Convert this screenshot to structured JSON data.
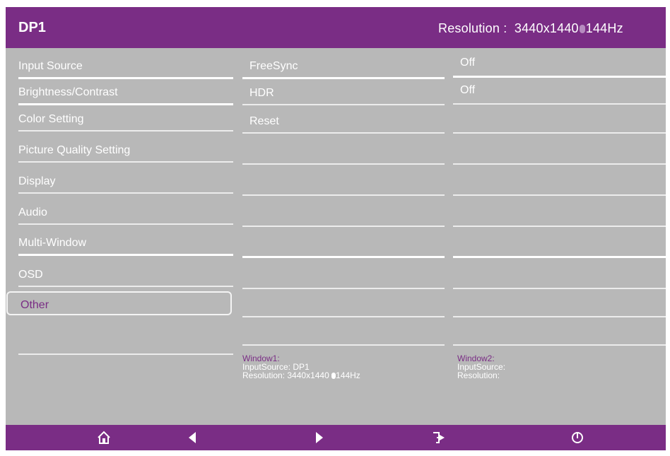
{
  "header": {
    "source": "DP1",
    "resolution_label": "Resolution :",
    "resolution_value": "3440x1440",
    "refresh": "144Hz"
  },
  "menu": {
    "items": [
      {
        "label": "Input Source"
      },
      {
        "label": "Brightness/Contrast"
      },
      {
        "label": "Color Setting"
      },
      {
        "label": "Picture Quality Setting"
      },
      {
        "label": "Display"
      },
      {
        "label": "Audio"
      },
      {
        "label": "Multi-Window"
      },
      {
        "label": "OSD"
      },
      {
        "label": "Other"
      }
    ],
    "selected_label": "Other"
  },
  "submenu": {
    "items": [
      {
        "label": "FreeSync"
      },
      {
        "label": "HDR"
      },
      {
        "label": "Reset"
      }
    ]
  },
  "values": {
    "items": [
      {
        "label": "Off"
      },
      {
        "label": "Off"
      }
    ]
  },
  "window1": {
    "title": "Window1:",
    "input_line": "InputSource:  DP1",
    "resolution_line_prefix": "Resolution:  3440x1440",
    "resolution_line_suffix": "144Hz"
  },
  "window2": {
    "title": "Window2:",
    "input_line": "InputSource:",
    "resolution_line": "Resolution:"
  },
  "footer": {
    "icons": [
      "home-icon",
      "left-arrow-icon",
      "right-arrow-icon",
      "exit-icon",
      "power-icon"
    ]
  },
  "colors": {
    "accent": "#7a2d85",
    "panel": "#b8b8b8",
    "text": "#ffffff"
  }
}
